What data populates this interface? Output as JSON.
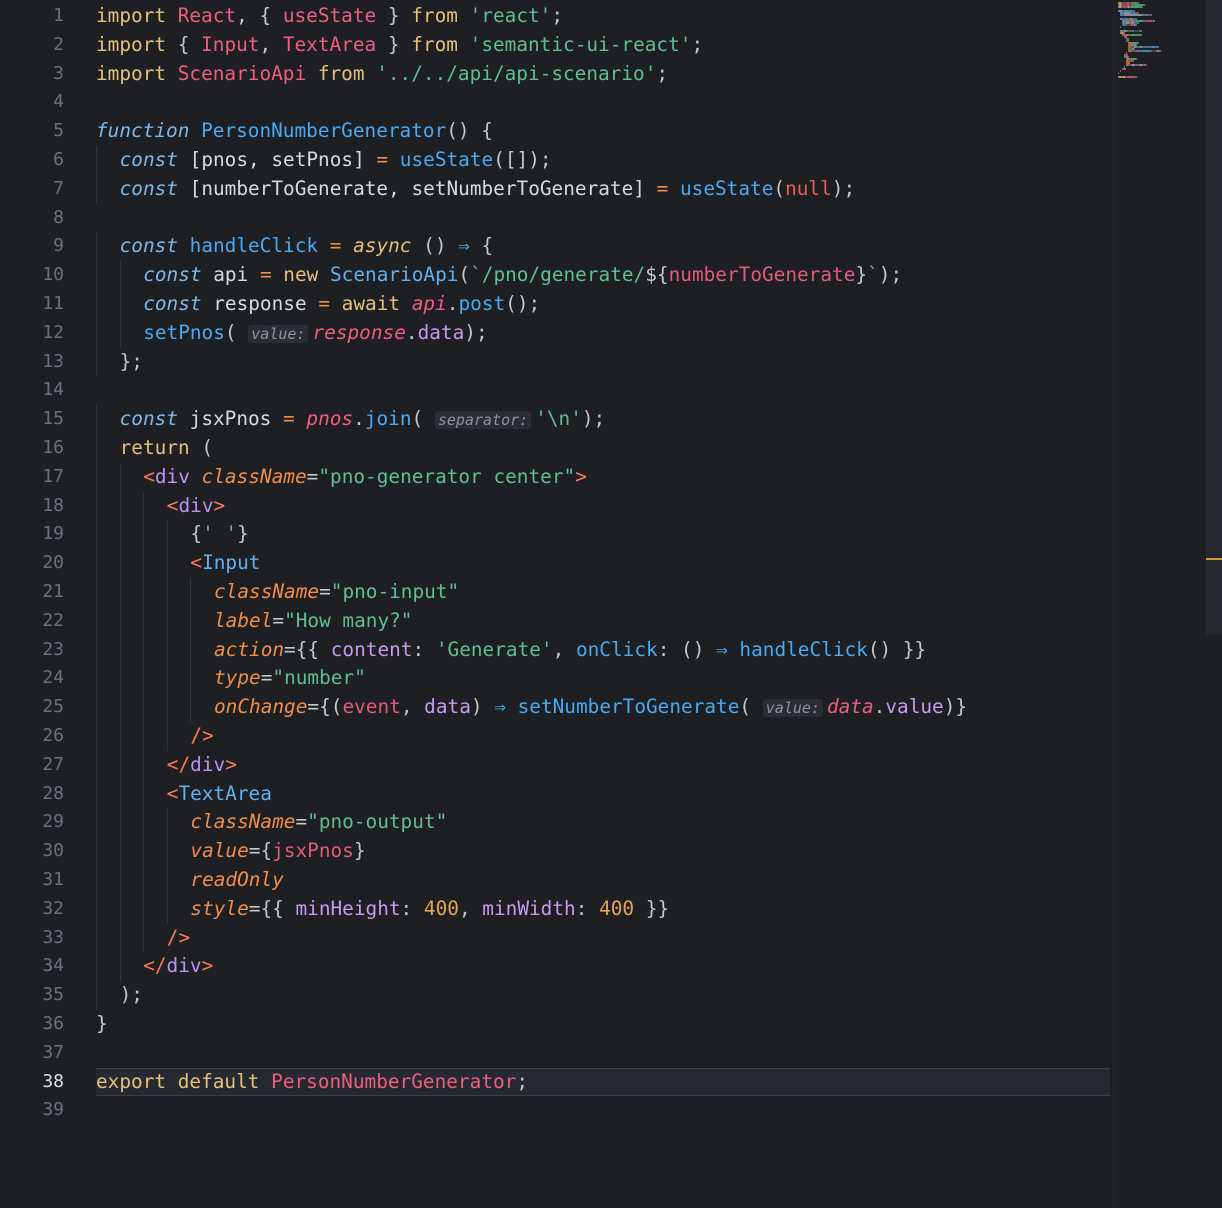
{
  "editor": {
    "current_line": 38,
    "line_numbers": [
      "1",
      "2",
      "3",
      "4",
      "5",
      "6",
      "7",
      "8",
      "9",
      "10",
      "11",
      "12",
      "13",
      "14",
      "15",
      "16",
      "17",
      "18",
      "19",
      "20",
      "21",
      "22",
      "23",
      "24",
      "25",
      "26",
      "27",
      "28",
      "29",
      "30",
      "31",
      "32",
      "33",
      "34",
      "35",
      "36",
      "37",
      "38",
      "39"
    ],
    "lines": [
      [
        [
          "kw",
          "import "
        ],
        [
          "cls",
          "React"
        ],
        [
          "punc",
          ", { "
        ],
        [
          "cls",
          "useState"
        ],
        [
          "punc",
          " } "
        ],
        [
          "kw",
          "from "
        ],
        [
          "str",
          "'react'"
        ],
        [
          "punc",
          ";"
        ]
      ],
      [
        [
          "kw",
          "import "
        ],
        [
          "punc",
          "{ "
        ],
        [
          "cls",
          "Input"
        ],
        [
          "punc",
          ", "
        ],
        [
          "cls",
          "TextArea"
        ],
        [
          "punc",
          " } "
        ],
        [
          "kw",
          "from "
        ],
        [
          "str",
          "'semantic-ui-react'"
        ],
        [
          "punc",
          ";"
        ]
      ],
      [
        [
          "kw",
          "import "
        ],
        [
          "cls",
          "ScenarioApi"
        ],
        [
          "kw",
          " from "
        ],
        [
          "str",
          "'../../api/api-scenario'"
        ],
        [
          "punc",
          ";"
        ]
      ],
      [],
      [
        [
          "stor",
          "function "
        ],
        [
          "fn",
          "PersonNumberGenerator"
        ],
        [
          "punc",
          "() {"
        ]
      ],
      [
        [
          "stor",
          "const "
        ],
        [
          "plain",
          "[pnos, setPnos] "
        ],
        [
          "op",
          "= "
        ],
        [
          "fn",
          "useState"
        ],
        [
          "punc",
          "([]);"
        ]
      ],
      [
        [
          "stor",
          "const "
        ],
        [
          "plain",
          "[numberToGenerate, setNumberToGenerate] "
        ],
        [
          "op",
          "= "
        ],
        [
          "fn",
          "useState"
        ],
        [
          "punc",
          "("
        ],
        [
          "nul",
          "null"
        ],
        [
          "punc",
          ");"
        ]
      ],
      [],
      [
        [
          "stor",
          "const "
        ],
        [
          "fn",
          "handleClick "
        ],
        [
          "op",
          "= "
        ],
        [
          "kwi",
          "async "
        ],
        [
          "punc",
          "() "
        ],
        [
          "arrow",
          "⇒ "
        ],
        [
          "punc",
          "{"
        ]
      ],
      [
        [
          "stor",
          "const "
        ],
        [
          "plain",
          "api "
        ],
        [
          "op",
          "= "
        ],
        [
          "kw",
          "new "
        ],
        [
          "comp",
          "ScenarioApi"
        ],
        [
          "punc",
          "("
        ],
        [
          "str",
          "`/pno/generate/"
        ],
        [
          "punc",
          "${"
        ],
        [
          "param",
          "numberToGenerate"
        ],
        [
          "punc",
          "}"
        ],
        [
          "str",
          "`"
        ],
        [
          "punc",
          ");"
        ]
      ],
      [
        [
          "stor",
          "const "
        ],
        [
          "plain",
          "response "
        ],
        [
          "op",
          "= "
        ],
        [
          "kw",
          "await "
        ],
        [
          "varI",
          "api"
        ],
        [
          "punc",
          "."
        ],
        [
          "fn",
          "post"
        ],
        [
          "punc",
          "();"
        ]
      ],
      [
        [
          "fn",
          "setPnos"
        ],
        [
          "punc",
          "( "
        ],
        [
          "inlay",
          "value:"
        ],
        [
          "varI",
          "response"
        ],
        [
          "punc",
          "."
        ],
        [
          "prop",
          "data"
        ],
        [
          "punc",
          ");"
        ]
      ],
      [
        [
          "punc",
          "};"
        ]
      ],
      [],
      [
        [
          "stor",
          "const "
        ],
        [
          "plain",
          "jsxPnos "
        ],
        [
          "op",
          "= "
        ],
        [
          "varI",
          "pnos"
        ],
        [
          "punc",
          "."
        ],
        [
          "fn",
          "join"
        ],
        [
          "punc",
          "( "
        ],
        [
          "inlay",
          "separator:"
        ],
        [
          "str",
          "'\\n'"
        ],
        [
          "punc",
          ");"
        ]
      ],
      [
        [
          "kw",
          "return "
        ],
        [
          "punc",
          "("
        ]
      ],
      [
        [
          "tag",
          "<"
        ],
        [
          "tagname",
          "div "
        ],
        [
          "attr",
          "className"
        ],
        [
          "punc",
          "="
        ],
        [
          "str",
          "\"pno-generator center\""
        ],
        [
          "tag",
          ">"
        ]
      ],
      [
        [
          "tag",
          "<"
        ],
        [
          "tagname",
          "div"
        ],
        [
          "tag",
          ">"
        ]
      ],
      [
        [
          "punc",
          "{"
        ],
        [
          "str",
          "' '"
        ],
        [
          "punc",
          "}"
        ]
      ],
      [
        [
          "tag",
          "<"
        ],
        [
          "comp",
          "Input"
        ]
      ],
      [
        [
          "attr",
          "className"
        ],
        [
          "punc",
          "="
        ],
        [
          "str",
          "\"pno-input\""
        ]
      ],
      [
        [
          "attr",
          "label"
        ],
        [
          "punc",
          "="
        ],
        [
          "str",
          "\"How many?\""
        ]
      ],
      [
        [
          "attr",
          "action"
        ],
        [
          "punc",
          "={{ "
        ],
        [
          "prop",
          "content"
        ],
        [
          "punc",
          ": "
        ],
        [
          "str",
          "'Generate'"
        ],
        [
          "punc",
          ", "
        ],
        [
          "fn",
          "onClick"
        ],
        [
          "punc",
          ": () "
        ],
        [
          "arrow",
          "⇒ "
        ],
        [
          "fn",
          "handleClick"
        ],
        [
          "punc",
          "() }}"
        ]
      ],
      [
        [
          "attr",
          "type"
        ],
        [
          "punc",
          "="
        ],
        [
          "str",
          "\"number\""
        ]
      ],
      [
        [
          "attr",
          "onChange"
        ],
        [
          "punc",
          "={("
        ],
        [
          "param",
          "event"
        ],
        [
          "punc",
          ", "
        ],
        [
          "prop",
          "data"
        ],
        [
          "punc",
          ") "
        ],
        [
          "arrow",
          "⇒ "
        ],
        [
          "fn",
          "setNumberToGenerate"
        ],
        [
          "punc",
          "( "
        ],
        [
          "inlay",
          "value:"
        ],
        [
          "varI",
          "data"
        ],
        [
          "punc",
          "."
        ],
        [
          "prop",
          "value"
        ],
        [
          "punc",
          ")}"
        ]
      ],
      [
        [
          "tag",
          "/>"
        ]
      ],
      [
        [
          "tag",
          "</"
        ],
        [
          "tagname",
          "div"
        ],
        [
          "tag",
          ">"
        ]
      ],
      [
        [
          "tag",
          "<"
        ],
        [
          "comp",
          "TextArea"
        ]
      ],
      [
        [
          "attr",
          "className"
        ],
        [
          "punc",
          "="
        ],
        [
          "str",
          "\"pno-output\""
        ]
      ],
      [
        [
          "attr",
          "value"
        ],
        [
          "punc",
          "={"
        ],
        [
          "param",
          "jsxPnos"
        ],
        [
          "punc",
          "}"
        ]
      ],
      [
        [
          "attr",
          "readOnly"
        ]
      ],
      [
        [
          "attr",
          "style"
        ],
        [
          "punc",
          "={{ "
        ],
        [
          "prop",
          "minHeight"
        ],
        [
          "punc",
          ": "
        ],
        [
          "num",
          "400"
        ],
        [
          "punc",
          ", "
        ],
        [
          "prop",
          "minWidth"
        ],
        [
          "punc",
          ": "
        ],
        [
          "num",
          "400"
        ],
        [
          "punc",
          " }}"
        ]
      ],
      [
        [
          "tag",
          "/>"
        ]
      ],
      [
        [
          "tag",
          "</"
        ],
        [
          "tagname",
          "div"
        ],
        [
          "tag",
          ">"
        ]
      ],
      [
        [
          "punc",
          ");"
        ]
      ],
      [
        [
          "punc",
          "}"
        ]
      ],
      [],
      [
        [
          "kw",
          "export "
        ],
        [
          "kw",
          "default "
        ],
        [
          "cls",
          "PersonNumberGenerator"
        ],
        [
          "punc",
          ";"
        ]
      ],
      []
    ]
  },
  "colors": {
    "background": "#1d1f23",
    "keyword": "#e5c07b",
    "string": "#5fbf8e",
    "function": "#4aa9f0",
    "class": "#ef5d7f"
  }
}
